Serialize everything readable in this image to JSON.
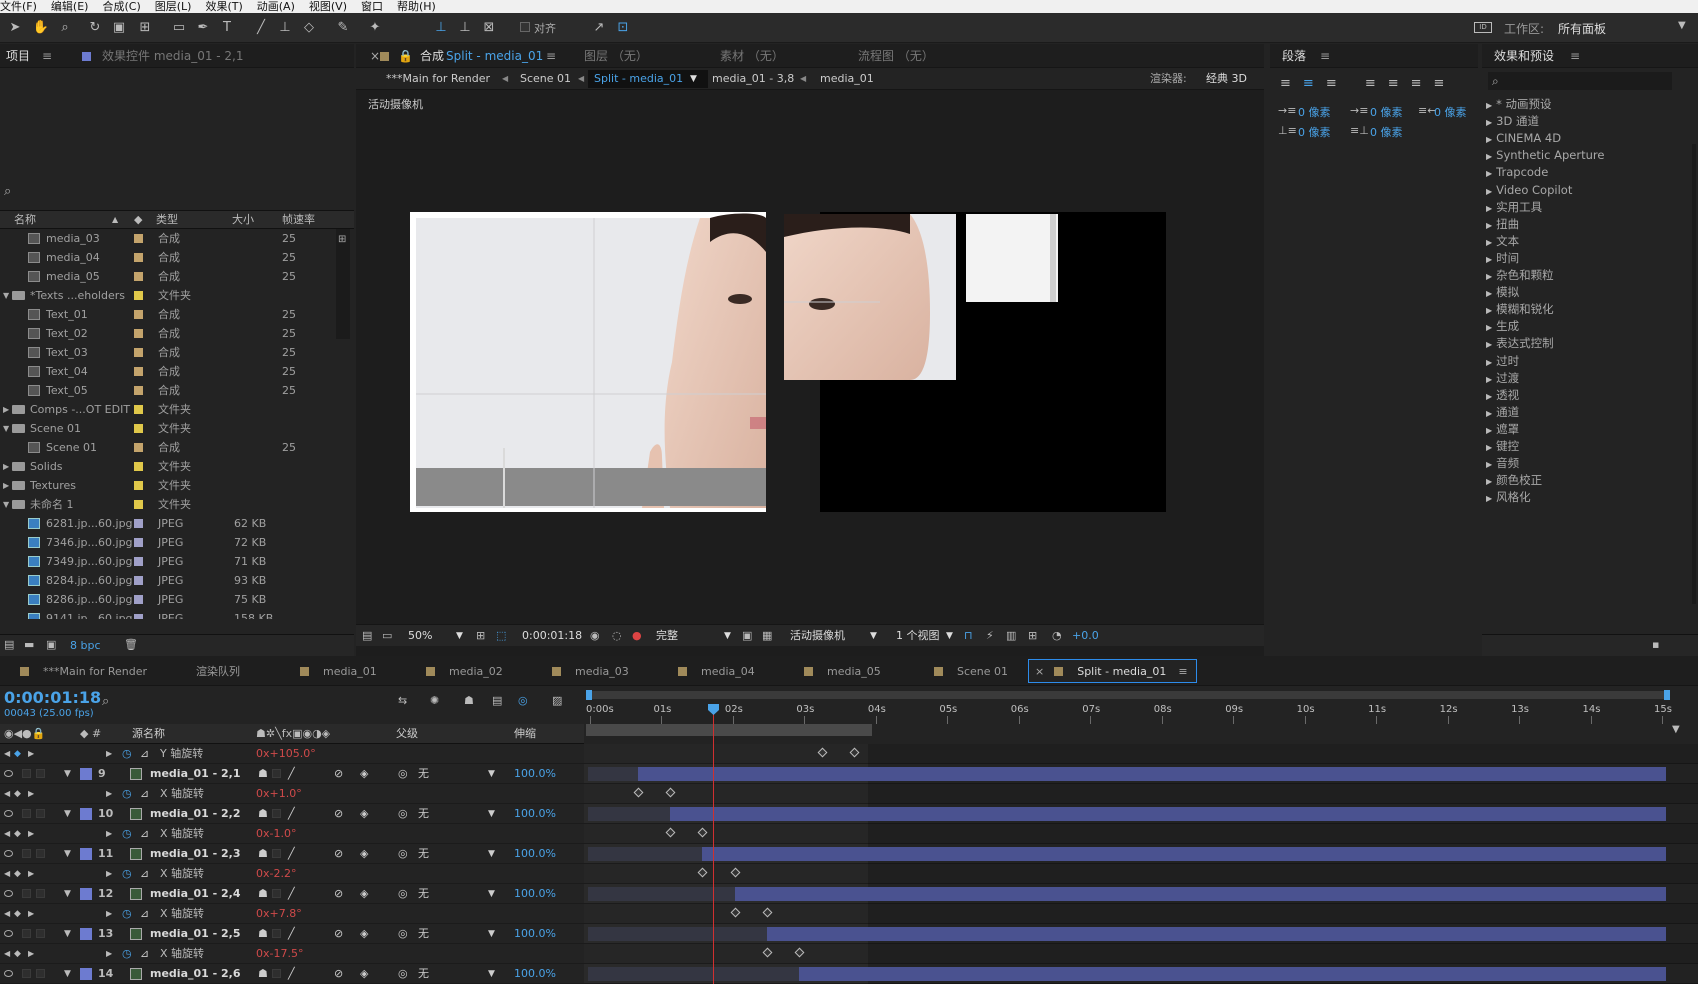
{
  "menu": [
    "文件(F)",
    "编辑(E)",
    "合成(C)",
    "图层(L)",
    "效果(T)",
    "动画(A)",
    "视图(V)",
    "窗口",
    "帮助(H)"
  ],
  "toolbar": {
    "align_label": "对齐",
    "workspace_label": "工作区:",
    "workspace_value": "所有面板"
  },
  "project_panel": {
    "tab_project": "项目",
    "tab_effect_controls": "效果控件 media_01 - 2,1",
    "columns": {
      "name": "名称",
      "type": "类型",
      "size": "大小",
      "rate": "帧速率"
    },
    "rows": [
      {
        "name": "media_03",
        "type": "合成",
        "size": "",
        "rate": "25",
        "kind": "comp",
        "indent": 1
      },
      {
        "name": "media_04",
        "type": "合成",
        "size": "",
        "rate": "25",
        "kind": "comp",
        "indent": 1
      },
      {
        "name": "media_05",
        "type": "合成",
        "size": "",
        "rate": "25",
        "kind": "comp",
        "indent": 1
      },
      {
        "name": "*Texts ...eholders",
        "type": "文件夹",
        "size": "",
        "rate": "",
        "kind": "folder",
        "indent": 0,
        "open": true
      },
      {
        "name": "Text_01",
        "type": "合成",
        "size": "",
        "rate": "25",
        "kind": "comp",
        "indent": 1
      },
      {
        "name": "Text_02",
        "type": "合成",
        "size": "",
        "rate": "25",
        "kind": "comp",
        "indent": 1
      },
      {
        "name": "Text_03",
        "type": "合成",
        "size": "",
        "rate": "25",
        "kind": "comp",
        "indent": 1
      },
      {
        "name": "Text_04",
        "type": "合成",
        "size": "",
        "rate": "25",
        "kind": "comp",
        "indent": 1
      },
      {
        "name": "Text_05",
        "type": "合成",
        "size": "",
        "rate": "25",
        "kind": "comp",
        "indent": 1
      },
      {
        "name": "Comps -...OT EDIT",
        "type": "文件夹",
        "size": "",
        "rate": "",
        "kind": "folder",
        "indent": 0,
        "open": false
      },
      {
        "name": "Scene 01",
        "type": "文件夹",
        "size": "",
        "rate": "",
        "kind": "folder",
        "indent": 0,
        "open": true
      },
      {
        "name": "Scene 01",
        "type": "合成",
        "size": "",
        "rate": "25",
        "kind": "comp",
        "indent": 1
      },
      {
        "name": "Solids",
        "type": "文件夹",
        "size": "",
        "rate": "",
        "kind": "folder",
        "indent": 0,
        "open": false
      },
      {
        "name": "Textures",
        "type": "文件夹",
        "size": "",
        "rate": "",
        "kind": "folder",
        "indent": 0,
        "open": false
      },
      {
        "name": "未命名 1",
        "type": "文件夹",
        "size": "",
        "rate": "",
        "kind": "folder",
        "indent": 0,
        "open": true
      },
      {
        "name": "6281.jp...60.jpg",
        "type": "JPEG",
        "size": "62 KB",
        "rate": "",
        "kind": "image",
        "indent": 1
      },
      {
        "name": "7346.jp...60.jpg",
        "type": "JPEG",
        "size": "72 KB",
        "rate": "",
        "kind": "image",
        "indent": 1
      },
      {
        "name": "7349.jp...60.jpg",
        "type": "JPEG",
        "size": "71 KB",
        "rate": "",
        "kind": "image",
        "indent": 1
      },
      {
        "name": "8284.jp...60.jpg",
        "type": "JPEG",
        "size": "93 KB",
        "rate": "",
        "kind": "image",
        "indent": 1
      },
      {
        "name": "8286.jp...60.jpg",
        "type": "JPEG",
        "size": "75 KB",
        "rate": "",
        "kind": "image",
        "indent": 1
      },
      {
        "name": "9141.jp...60.jpg",
        "type": "JPEG",
        "size": "158 KB",
        "rate": "",
        "kind": "image",
        "indent": 1
      }
    ],
    "bpc": "8 bpc"
  },
  "comp_panel": {
    "tab_label": "合成",
    "tab_comp_name": "Split - media_01",
    "tab_layer": "图层 （无）",
    "tab_footage": "素材 （无）",
    "tab_flowchart": "流程图 （无）",
    "breadcrumbs": [
      "***Main for Render",
      "Scene 01",
      "Split - media_01",
      "media_01 - 3,8",
      "media_01"
    ],
    "renderer_label": "渲染器:",
    "renderer_value": "经典 3D",
    "camera_label": "活动摄像机",
    "zoom": "50%",
    "timecode": "0:00:01:18",
    "resolution": "完整",
    "view_camera": "活动摄像机",
    "views": "1 个视图",
    "exposure": "+0.0"
  },
  "paragraph_panel": {
    "title": "段落",
    "indent_left": "0 像素",
    "indent_first": "0 像素",
    "indent_right": "0 像素",
    "space_before": "0 像素",
    "space_after": "0 像素"
  },
  "effects_panel": {
    "title": "效果和预设",
    "items": [
      "* 动画预设",
      "3D 通道",
      "CINEMA 4D",
      "Synthetic Aperture",
      "Trapcode",
      "Video Copilot",
      "实用工具",
      "扭曲",
      "文本",
      "时间",
      "杂色和颗粒",
      "模拟",
      "模糊和锐化",
      "生成",
      "表达式控制",
      "过时",
      "过渡",
      "透视",
      "通道",
      "遮罩",
      "键控",
      "音频",
      "颜色校正",
      "风格化"
    ]
  },
  "timeline": {
    "tabs": [
      "***Main for Render",
      "渲染队列",
      "media_01",
      "media_02",
      "media_03",
      "media_04",
      "media_05",
      "Scene 01",
      "Split - media_01"
    ],
    "timecode": "0:00:01:18",
    "frame_info": "00043 (25.00 fps)",
    "col_source": "源名称",
    "col_parent": "父级",
    "col_stretch": "伸缩",
    "ruler": [
      "0:00s",
      "01s",
      "02s",
      "03s",
      "04s",
      "05s",
      "06s",
      "07s",
      "08s",
      "09s",
      "10s",
      "11s",
      "12s",
      "13s",
      "14s",
      "15s"
    ],
    "rows": [
      {
        "kind": "prop",
        "name": "Y 轴旋转",
        "value": "0x+105.0°",
        "kf": [
          0.217,
          0.247
        ]
      },
      {
        "kind": "layer",
        "num": "9",
        "name": "media_01 - 2,1",
        "parent": "无",
        "stretch": "100.0%",
        "bar_start": 0.046
      },
      {
        "kind": "prop",
        "name": "X 轴旋转",
        "value": "0x+1.0°",
        "kf": [
          0.046,
          0.076
        ]
      },
      {
        "kind": "layer",
        "num": "10",
        "name": "media_01 - 2,2",
        "parent": "无",
        "stretch": "100.0%",
        "bar_start": 0.076
      },
      {
        "kind": "prop",
        "name": "X 轴旋转",
        "value": "0x-1.0°",
        "kf": [
          0.076,
          0.106
        ]
      },
      {
        "kind": "layer",
        "num": "11",
        "name": "media_01 - 2,3",
        "parent": "无",
        "stretch": "100.0%",
        "bar_start": 0.106
      },
      {
        "kind": "prop",
        "name": "X 轴旋转",
        "value": "0x-2.2°",
        "kf": [
          0.106,
          0.136
        ]
      },
      {
        "kind": "layer",
        "num": "12",
        "name": "media_01 - 2,4",
        "parent": "无",
        "stretch": "100.0%",
        "bar_start": 0.136
      },
      {
        "kind": "prop",
        "name": "X 轴旋转",
        "value": "0x+7.8°",
        "kf": [
          0.136,
          0.166
        ]
      },
      {
        "kind": "layer",
        "num": "13",
        "name": "media_01 - 2,5",
        "parent": "无",
        "stretch": "100.0%",
        "bar_start": 0.166
      },
      {
        "kind": "prop",
        "name": "X 轴旋转",
        "value": "0x-17.5°",
        "kf": [
          0.166,
          0.196
        ]
      },
      {
        "kind": "layer",
        "num": "14",
        "name": "media_01 - 2,6",
        "parent": "无",
        "stretch": "100.0%",
        "bar_start": 0.196
      }
    ]
  },
  "colors": {
    "accent_blue": "#2d8ceb",
    "layer_bar": "#4a5290",
    "playhead": "#d03030",
    "keyframe_value": "#d04a4a"
  }
}
